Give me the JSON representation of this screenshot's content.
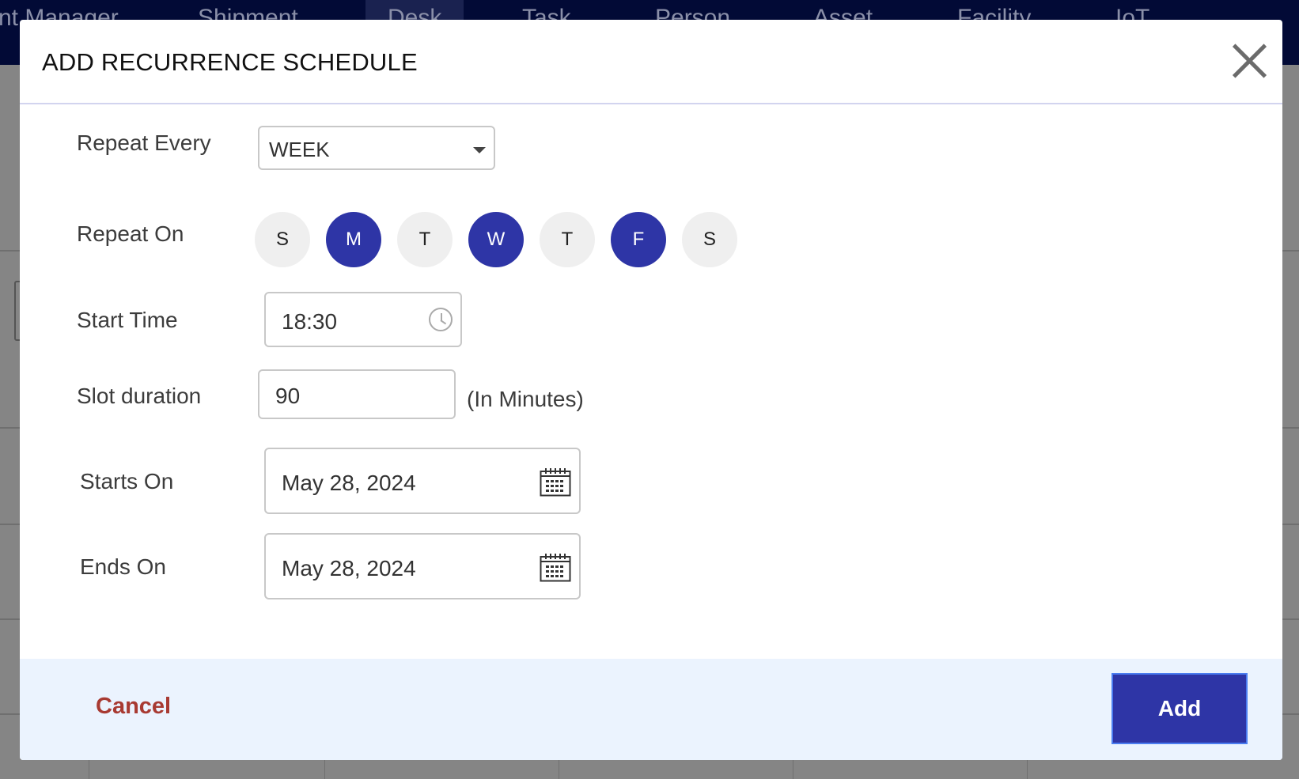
{
  "background_nav": [
    "nt Manager",
    "Shipment",
    "Desk",
    "Task",
    "Person",
    "Asset",
    "Facility",
    "IoT"
  ],
  "modal": {
    "title": "ADD RECURRENCE SCHEDULE",
    "close_icon": "close-icon"
  },
  "form": {
    "repeat_every": {
      "label": "Repeat Every",
      "value": "WEEK"
    },
    "repeat_on": {
      "label": "Repeat On",
      "days": [
        {
          "letter": "S",
          "selected": false
        },
        {
          "letter": "M",
          "selected": true
        },
        {
          "letter": "T",
          "selected": false
        },
        {
          "letter": "W",
          "selected": true
        },
        {
          "letter": "T",
          "selected": false
        },
        {
          "letter": "F",
          "selected": true
        },
        {
          "letter": "S",
          "selected": false
        }
      ]
    },
    "start_time": {
      "label": "Start Time",
      "value": "18:30",
      "icon": "clock-icon"
    },
    "slot_duration": {
      "label": "Slot duration",
      "value": "90",
      "unit": "(In Minutes)"
    },
    "starts_on": {
      "label": "Starts On",
      "value": "May 28, 2024",
      "icon": "calendar-icon"
    },
    "ends_on": {
      "label": "Ends On",
      "value": "May 28, 2024",
      "icon": "calendar-icon"
    }
  },
  "footer": {
    "cancel_label": "Cancel",
    "add_label": "Add"
  },
  "colors": {
    "primary": "#2e35a6",
    "cancel": "#a83a32",
    "footer_bg": "#ebf3fe",
    "nav_bg": "#020a36"
  }
}
